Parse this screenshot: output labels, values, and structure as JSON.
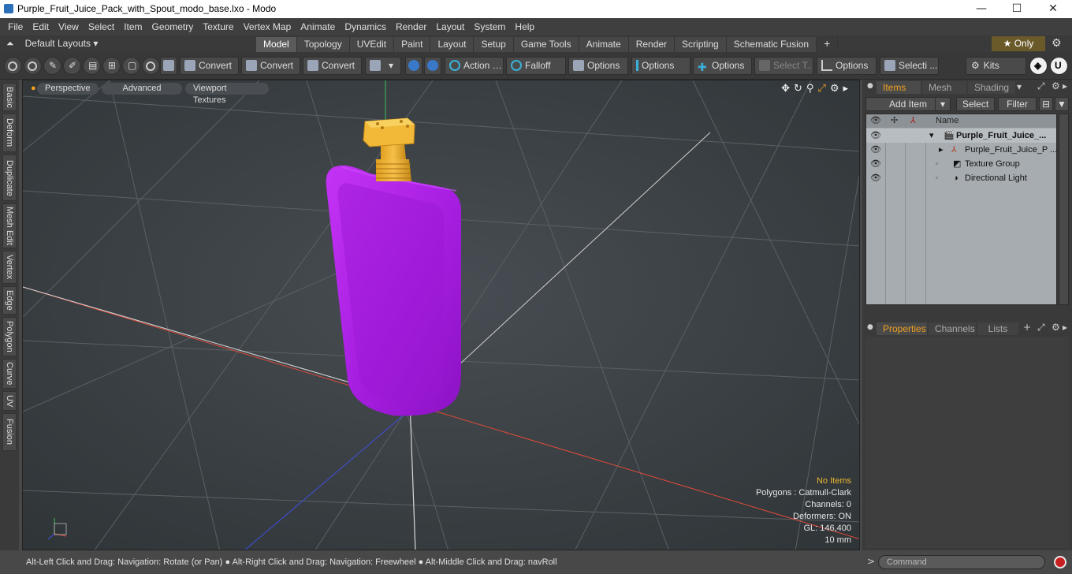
{
  "window": {
    "title": "Purple_Fruit_Juice_Pack_with_Spout_modo_base.lxo - Modo",
    "minimize": "—",
    "maximize": "☐",
    "close": "✕"
  },
  "menu": [
    "File",
    "Edit",
    "View",
    "Select",
    "Item",
    "Geometry",
    "Texture",
    "Vertex Map",
    "Animate",
    "Dynamics",
    "Render",
    "Layout",
    "System",
    "Help"
  ],
  "layouts": {
    "label": "Default Layouts ▾"
  },
  "tabs": [
    "Model",
    "Topology",
    "UVEdit",
    "Paint",
    "Layout",
    "Setup",
    "Game Tools",
    "Animate",
    "Render",
    "Scripting",
    "Schematic Fusion",
    "+"
  ],
  "only": "★ Only",
  "toolbar": {
    "convert1": "Convert",
    "convert2": "Convert",
    "convert3": "Convert",
    "action": "Action",
    "falloff": "Falloff",
    "options1": "Options",
    "options2": "Options",
    "options3": "Options",
    "select_t": "Select T...",
    "options4": "Options",
    "selecti": "Selecti ...",
    "kits": "Kits"
  },
  "left_tabs": [
    "Basic",
    "Deform",
    "Duplicate",
    "Mesh Edit",
    "Vertex",
    "Edge",
    "Polygon",
    "Curve",
    "UV",
    "Fusion"
  ],
  "viewport": {
    "tabs": [
      "Perspective",
      "Advanced",
      "Viewport Textures"
    ],
    "stats": {
      "no_items": "No Items",
      "polygons": "Polygons : Catmull-Clark",
      "channels": "Channels: 0",
      "deformers": "Deformers: ON",
      "gl": "GL: 146,400",
      "scale": "10 mm"
    }
  },
  "items_panel": {
    "tabs": [
      "Items",
      "Mesh ...",
      "Shading"
    ],
    "add_item": "Add Item",
    "select": "Select",
    "filter": "Filter",
    "name_header": "Name",
    "rows": [
      {
        "label": "Purple_Fruit_Juice_...",
        "bold": true
      },
      {
        "label": "Purple_Fruit_Juice_P ..."
      },
      {
        "label": "Texture Group"
      },
      {
        "label": "Directional Light"
      }
    ]
  },
  "properties_panel": {
    "tabs": [
      "Properties",
      "Channels",
      "Lists",
      "+"
    ]
  },
  "status": {
    "text": "Alt-Left Click and Drag: Navigation: Rotate (or Pan) ● Alt-Right Click and Drag: Navigation: Freewheel ● Alt-Middle Click and Drag: navRoll"
  },
  "command": {
    "placeholder": "Command"
  },
  "colors": {
    "pouch": "#b020e8",
    "spout": "#f0b030",
    "active_tab": "#f0a020"
  }
}
